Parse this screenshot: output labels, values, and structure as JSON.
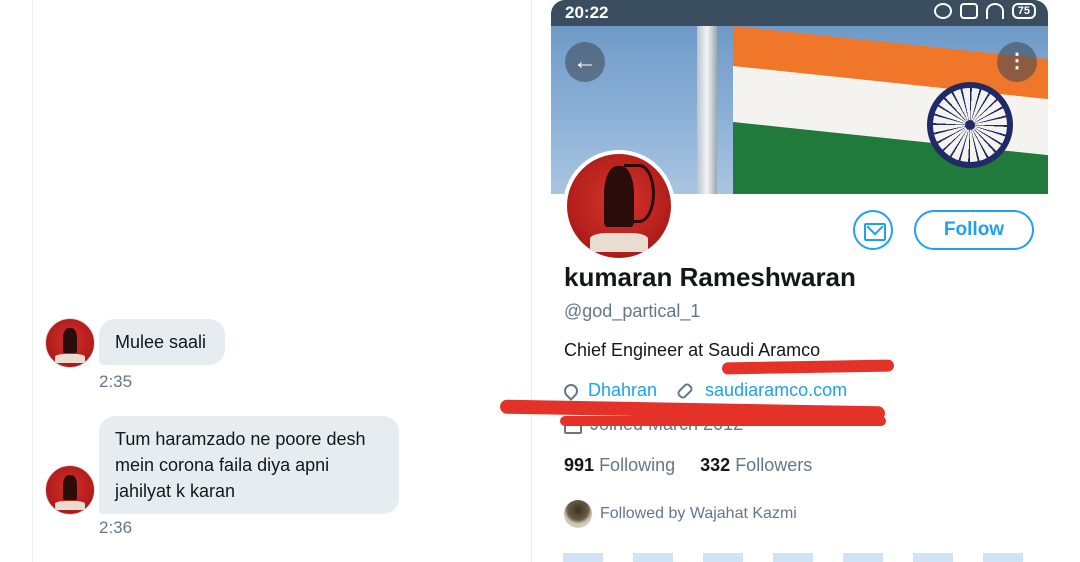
{
  "dm": {
    "messages": [
      {
        "text": "Mulee saali",
        "time": "2:35"
      },
      {
        "text": "Tum haramzado ne poore desh mein corona faila diya apni jahilyat k karan",
        "time": "2:36"
      }
    ]
  },
  "profile": {
    "status_bar": {
      "time": "20:22",
      "battery": "75"
    },
    "name": "kumaran Rameshwaran",
    "handle": "@god_partical_1",
    "bio": "Chief Engineer at Saudi Aramco",
    "location": "Dhahran",
    "website": "saudiaramco.com",
    "joined": "Joined March 2012",
    "following_count": "991",
    "following_label": "Following",
    "followers_count": "332",
    "followers_label": "Followers",
    "followed_by": "Followed by Wajahat Kazmi",
    "follow_label": "Follow",
    "icons": [
      "back-arrow-icon",
      "more-icon",
      "mail-icon",
      "location-icon",
      "link-icon",
      "calendar-icon"
    ]
  },
  "colors": {
    "accent": "#1da1f2",
    "strike": "#e53228",
    "bubble": "#e6ecf0",
    "muted": "#657786"
  }
}
